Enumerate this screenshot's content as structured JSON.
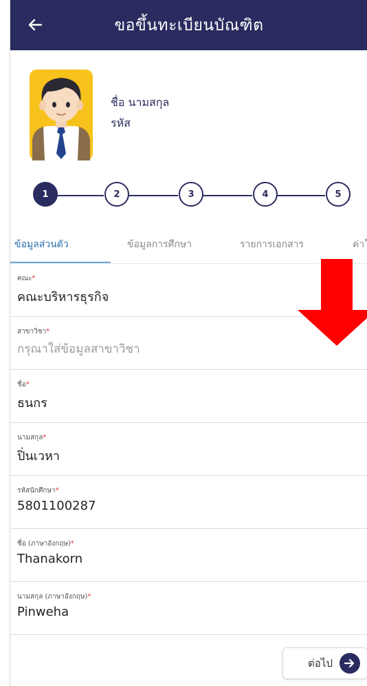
{
  "header": {
    "title": "ขอขึ้นทะเบียนบัณฑิต",
    "back_icon": "arrow-left-icon"
  },
  "profile": {
    "name_label": "ชื่อ นามสกุล",
    "id_label": "รหัส",
    "avatar_icon": "student-avatar-icon"
  },
  "stepper": {
    "steps": [
      "1",
      "2",
      "3",
      "4",
      "5"
    ],
    "active_step": 1
  },
  "tabs": [
    {
      "label": "ข้อมูลส่วนตัว",
      "active": true
    },
    {
      "label": "ข้อมูลการศึกษา",
      "active": false
    },
    {
      "label": "รายการเอกสาร",
      "active": false
    },
    {
      "label": "ค่าใ",
      "active": false
    }
  ],
  "form": {
    "fields": [
      {
        "label": "คณะ",
        "required_mark": "*",
        "value": "คณะบริหารธุรกิจ"
      },
      {
        "label": "สาขาวิชา",
        "required_mark": "*",
        "value": "กรุณาใส่ข้อมูลสาขาวิชา",
        "is_placeholder": true
      },
      {
        "label": "ชื่อ",
        "required_mark": "*",
        "value": "ธนกร"
      },
      {
        "label": "นามสกุล",
        "required_mark": "*",
        "value": "ปิ่นเวหา"
      },
      {
        "label": "รหัสนักศึกษา",
        "required_mark": "*",
        "value": "5801100287"
      },
      {
        "label": "ชื่อ (ภาษาอังกฤษ)",
        "required_mark": "*",
        "value": "Thanakorn"
      },
      {
        "label": "นามสกุล (ภาษาอังกฤษ)",
        "required_mark": "*",
        "value": "Pinweha"
      }
    ]
  },
  "next_button": {
    "label": "ต่อไป",
    "icon": "arrow-right-icon"
  },
  "annotation": {
    "icon": "red-down-arrow-icon",
    "color": "#ff0000"
  },
  "colors": {
    "primary": "#2a2b5f",
    "tab_active": "#2b6fae",
    "required": "#e0404a"
  }
}
